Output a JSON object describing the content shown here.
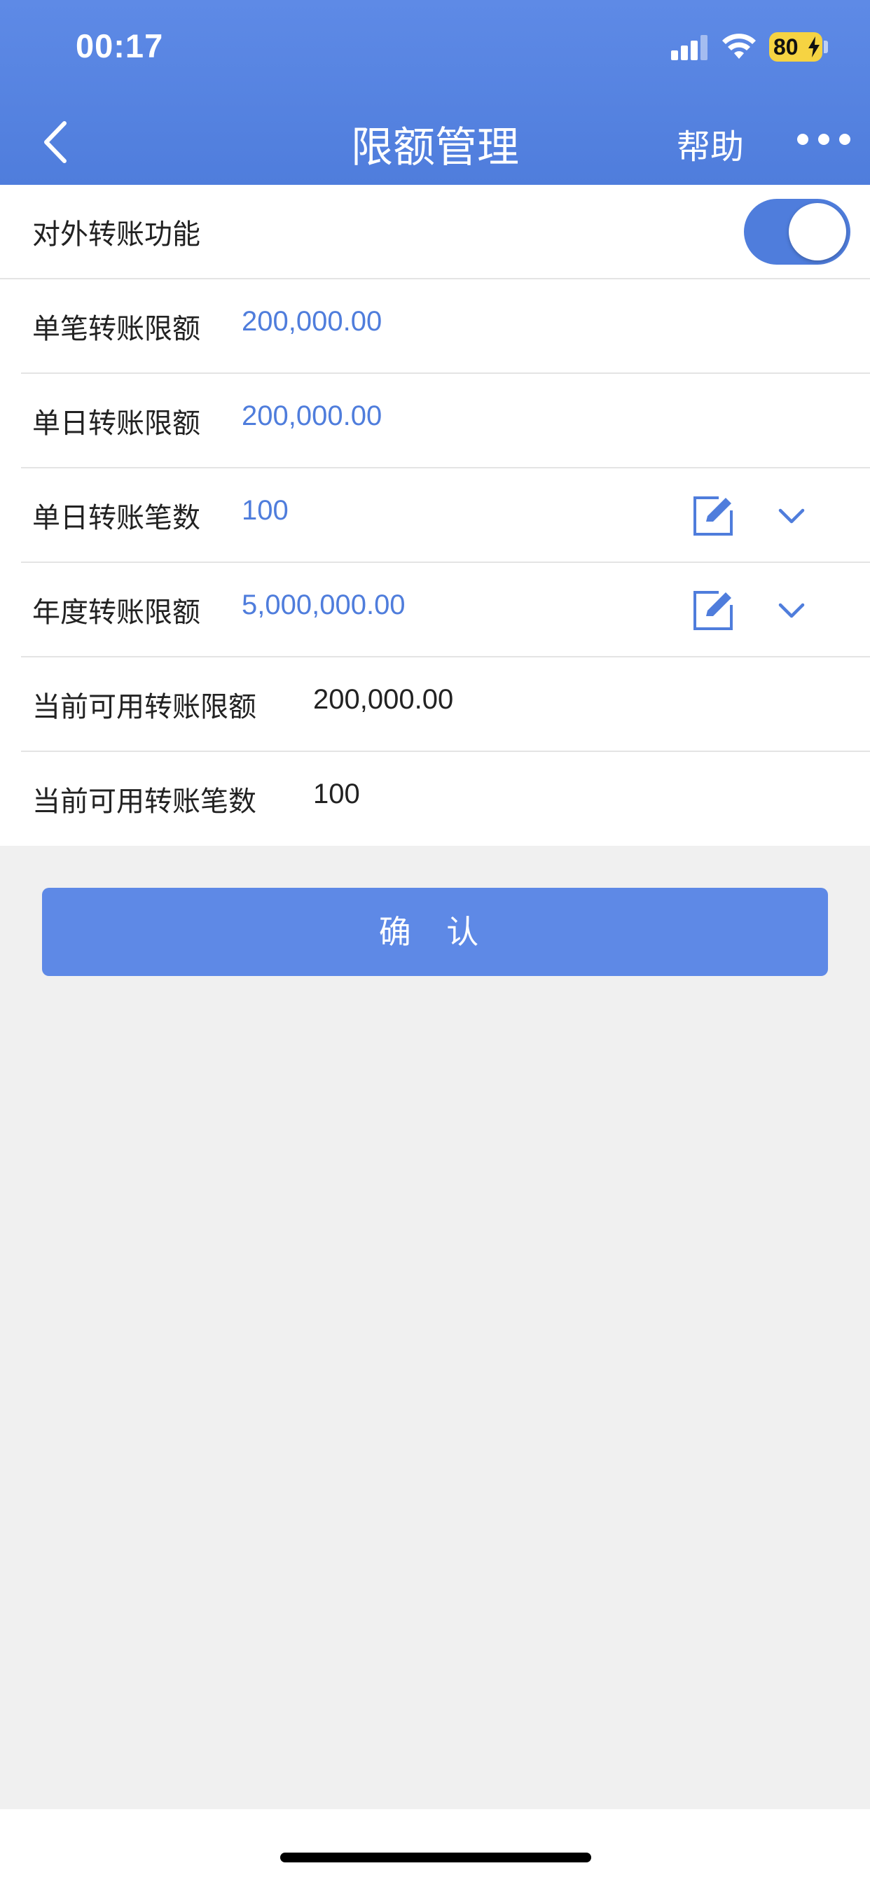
{
  "status_bar": {
    "time": "00:17",
    "battery_level": "80",
    "icons": [
      "signal-icon",
      "wifi-icon",
      "battery-charging-icon"
    ]
  },
  "header": {
    "title": "限额管理",
    "help_label": "帮助",
    "back_icon": "chevron-left-icon",
    "more_icon": "more-dots-icon",
    "accent_color": "#4f7ddc"
  },
  "settings": {
    "external_transfer": {
      "label": "对外转账功能",
      "enabled": true
    },
    "rows": [
      {
        "label": "单笔转账限额",
        "value": "200,000.00"
      },
      {
        "label": "单日转账限额",
        "value": "200,000.00"
      },
      {
        "label": "单日转账笔数",
        "value": "100",
        "editable": true
      },
      {
        "label": "年度转账限额",
        "value": "5,000,000.00",
        "editable": true
      },
      {
        "label": "当前可用转账限额",
        "value": "200,000.00"
      },
      {
        "label": "当前可用转账笔数",
        "value": "100"
      }
    ]
  },
  "actions": {
    "confirm_label": "确 认"
  }
}
